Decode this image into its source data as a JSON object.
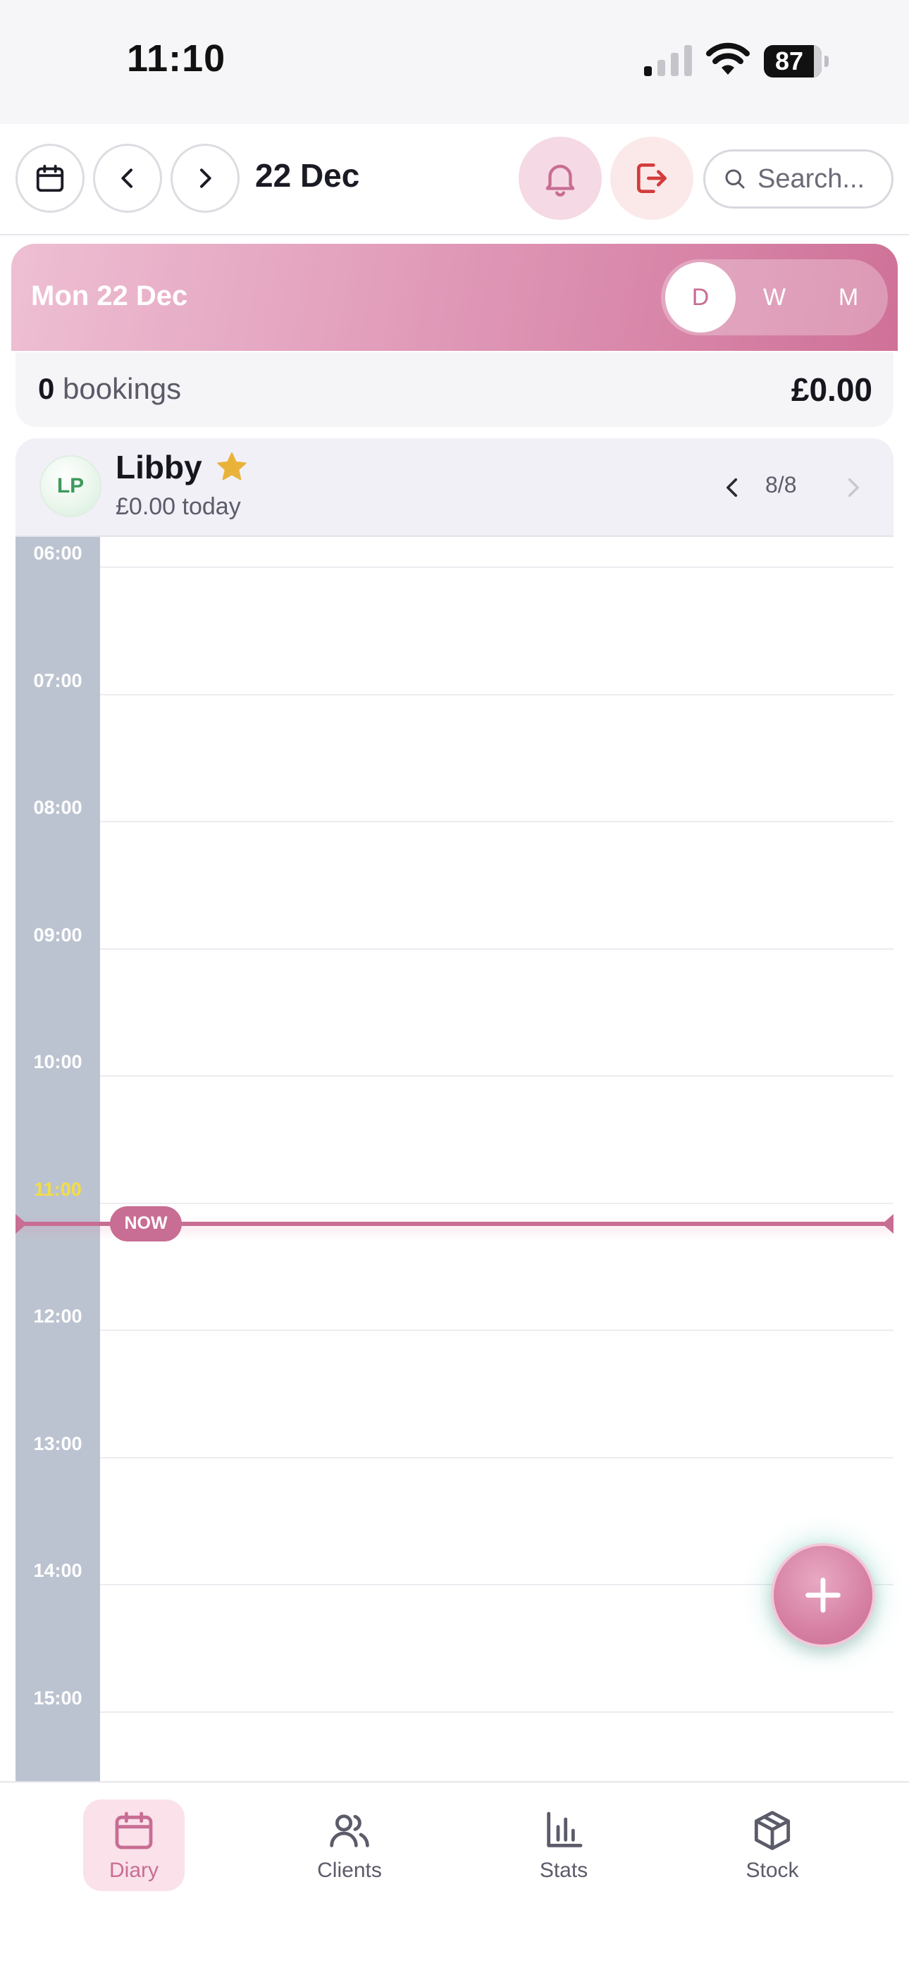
{
  "status_bar": {
    "time": "11:10",
    "battery": "87",
    "battery_level": 0.87
  },
  "header": {
    "date": "22 Dec",
    "search_placeholder": "Search..."
  },
  "day": {
    "title": "Mon 22 Dec",
    "views": [
      "D",
      "W",
      "M"
    ],
    "active_view": "D"
  },
  "summary": {
    "count": "0",
    "count_label": "bookings",
    "total": "£0.00"
  },
  "staff": {
    "initials": "LP",
    "name": "Libby",
    "today": "£0.00 today",
    "page": "8/8"
  },
  "timeline": {
    "hours": [
      "06:00",
      "07:00",
      "08:00",
      "09:00",
      "10:00",
      "11:00",
      "12:00",
      "13:00",
      "14:00",
      "15:00"
    ],
    "current_hour": "11:00",
    "now_label": "NOW"
  },
  "tabs": [
    {
      "label": "Diary",
      "icon": "calendar-icon",
      "active": true
    },
    {
      "label": "Clients",
      "icon": "users-icon",
      "active": false
    },
    {
      "label": "Stats",
      "icon": "bar-chart-icon",
      "active": false
    },
    {
      "label": "Stock",
      "icon": "box-icon",
      "active": false
    }
  ],
  "colors": {
    "accent": "#c86d93",
    "now_hour_label": "#f4dd45",
    "star": "#e9b33a",
    "logout": "#d43c3c"
  }
}
